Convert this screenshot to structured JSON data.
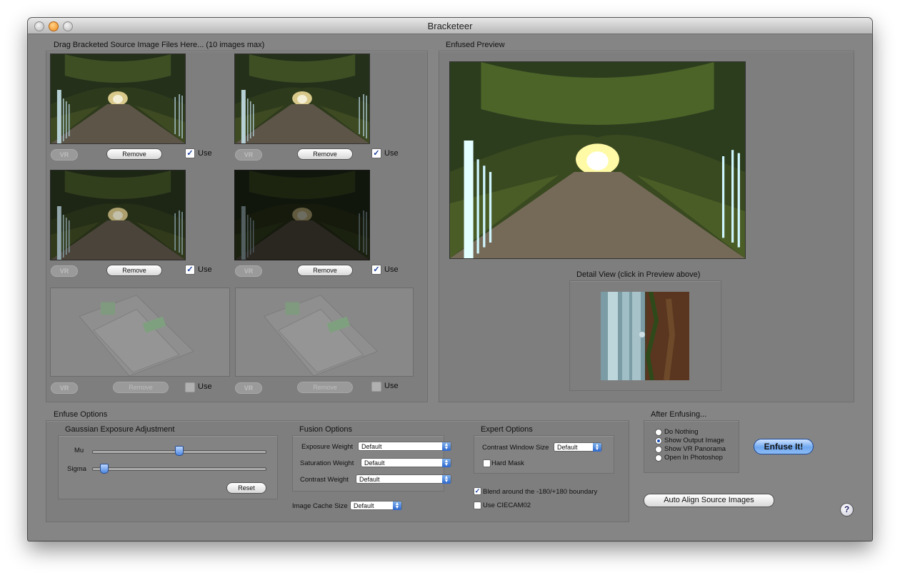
{
  "window": {
    "title": "Bracketeer"
  },
  "source": {
    "heading": "Drag Bracketed Source Image Files Here... (10 images max)",
    "slots": [
      {
        "vr": "VR",
        "remove": "Remove",
        "use": "Use",
        "checked": true,
        "filled": true
      },
      {
        "vr": "VR",
        "remove": "Remove",
        "use": "Use",
        "checked": true,
        "filled": true
      },
      {
        "vr": "VR",
        "remove": "Remove",
        "use": "Use",
        "checked": true,
        "filled": true
      },
      {
        "vr": "VR",
        "remove": "Remove",
        "use": "Use",
        "checked": true,
        "filled": true
      },
      {
        "vr": "VR",
        "remove": "Remove",
        "use": "Use",
        "checked": false,
        "filled": false
      },
      {
        "vr": "VR",
        "remove": "Remove",
        "use": "Use",
        "checked": false,
        "filled": false
      }
    ]
  },
  "preview": {
    "heading": "Enfused Preview",
    "detail_label": "Detail View (click in Preview above)"
  },
  "enfuse_options": {
    "heading": "Enfuse Options",
    "gaussian": {
      "heading": "Gaussian Exposure Adjustment",
      "mu_label": "Mu",
      "mu_value": 0.5,
      "sigma_label": "Sigma",
      "sigma_value": 0.05,
      "reset": "Reset"
    },
    "fusion": {
      "heading": "Fusion Options",
      "exposure_label": "Exposure Weight",
      "exposure_value": "Default",
      "saturation_label": "Saturation Weight",
      "saturation_value": "Default",
      "contrast_label": "Contrast Weight",
      "contrast_value": "Default"
    },
    "cache_label": "Image Cache Size",
    "cache_value": "Default",
    "expert": {
      "heading": "Expert Options",
      "window_label": "Contrast Window Size",
      "window_value": "Default",
      "hard_mask": "Hard Mask"
    },
    "blend_label": "Blend around the -180/+180 boundary",
    "ciecam_label": "Use CIECAM02"
  },
  "after": {
    "heading": "After Enfusing...",
    "options": [
      "Do Nothing",
      "Show Output Image",
      "Show VR Panorama",
      "Open In Photoshop"
    ],
    "selected": 1
  },
  "buttons": {
    "enfuse": "Enfuse It!",
    "align": "Auto Align Source Images",
    "help": "?"
  },
  "colors": {
    "accent": "#4a86e8",
    "window": "#858585"
  }
}
